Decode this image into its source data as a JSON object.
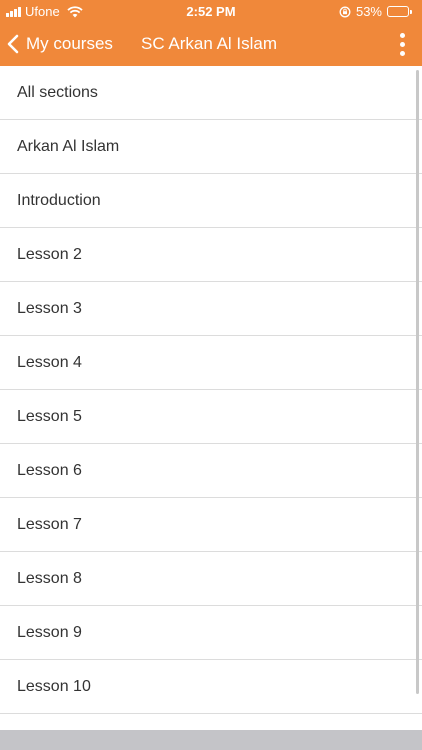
{
  "colors": {
    "accent": "#f0883a",
    "divider": "#dcdcdc",
    "text": "#333333"
  },
  "status_bar": {
    "carrier": "Ufone",
    "time": "2:52 PM",
    "battery_percent": "53%",
    "battery_level": 0.53
  },
  "nav": {
    "back_label": "My courses",
    "title": "SC Arkan Al Islam"
  },
  "sections": [
    "All sections",
    "Arkan Al Islam",
    "Introduction",
    "Lesson 2",
    "Lesson 3",
    "Lesson 4",
    "Lesson 5",
    "Lesson 6",
    "Lesson 7",
    "Lesson 8",
    "Lesson 9",
    "Lesson 10"
  ]
}
